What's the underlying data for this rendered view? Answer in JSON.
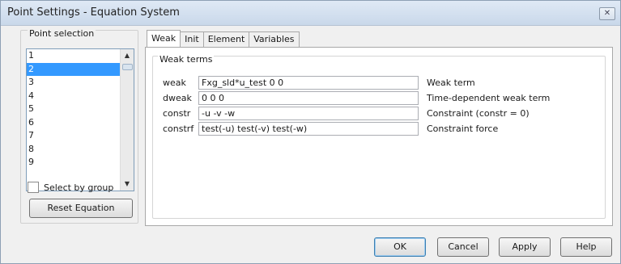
{
  "window": {
    "title": "Point Settings - Equation System",
    "close_label": "✕"
  },
  "point_selection": {
    "label": "Point selection",
    "items": [
      "1",
      "2",
      "3",
      "4",
      "5",
      "6",
      "7",
      "8",
      "9"
    ],
    "selected_index": 1,
    "select_by_group_label": "Select by group",
    "select_by_group_checked": false,
    "reset_label": "Reset Equation"
  },
  "tabs": [
    "Weak",
    "Init",
    "Element",
    "Variables"
  ],
  "active_tab": "Weak",
  "weak_terms": {
    "label": "Weak terms",
    "rows": [
      {
        "name": "weak",
        "value": "Fxg_sld*u_test 0 0",
        "desc": "Weak term"
      },
      {
        "name": "dweak",
        "value": "0 0 0",
        "desc": "Time-dependent weak term"
      },
      {
        "name": "constr",
        "value": "-u -v -w",
        "desc": "Constraint (constr = 0)"
      },
      {
        "name": "constrf",
        "value": "test(-u) test(-v) test(-w)",
        "desc": "Constraint force"
      }
    ]
  },
  "buttons": {
    "ok": "OK",
    "cancel": "Cancel",
    "apply": "Apply",
    "help": "Help"
  },
  "colors": {
    "selection": "#3399ff",
    "title_bar": "#c9d8ea"
  }
}
